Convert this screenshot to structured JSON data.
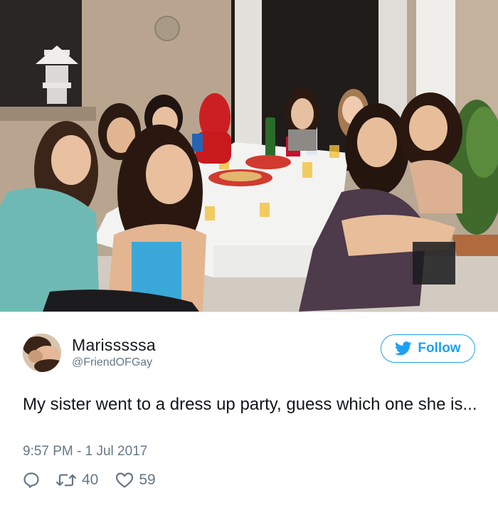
{
  "tweet": {
    "display_name": "Marisssssa",
    "handle": "@FriendOFGay",
    "text": "My sister went to a dress up party, guess which one she is...",
    "timestamp": "9:57 PM - 1 Jul 2017",
    "follow_label": "Follow",
    "retweet_count": "40",
    "like_count": "59"
  },
  "colors": {
    "accent": "#1da1f2",
    "secondary_text": "#657786",
    "primary_text": "#14171a"
  },
  "icons": {
    "follow": "twitter-bird-icon",
    "reply": "reply-icon",
    "retweet": "retweet-icon",
    "like": "heart-icon"
  }
}
